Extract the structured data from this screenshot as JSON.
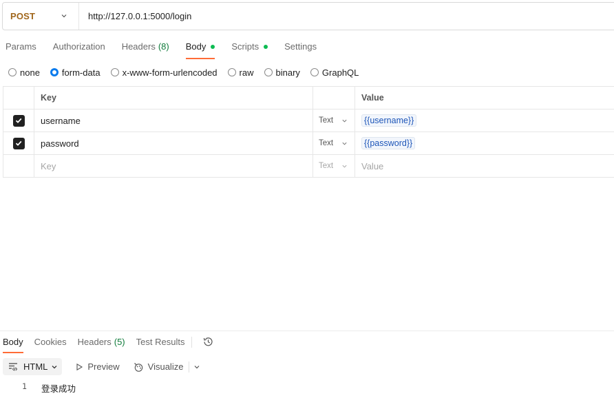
{
  "request": {
    "method": "POST",
    "url": "http://127.0.0.1:5000/login"
  },
  "request_tabs": [
    {
      "label": "Params"
    },
    {
      "label": "Authorization"
    },
    {
      "label": "Headers",
      "count": "(8)"
    },
    {
      "label": "Body",
      "active": true,
      "dot": true
    },
    {
      "label": "Scripts",
      "dot": true
    },
    {
      "label": "Settings"
    }
  ],
  "body_types": [
    "none",
    "form-data",
    "x-www-form-urlencoded",
    "raw",
    "binary",
    "GraphQL"
  ],
  "body_selected": "form-data",
  "table": {
    "header": {
      "key": "Key",
      "value": "Value"
    },
    "rows": [
      {
        "checked": true,
        "key": "username",
        "type": "Text",
        "value": "{{username}}"
      },
      {
        "checked": true,
        "key": "password",
        "type": "Text",
        "value": "{{password}}"
      }
    ],
    "empty_row": {
      "key_placeholder": "Key",
      "type": "Text",
      "value_placeholder": "Value"
    }
  },
  "response": {
    "tabs": [
      {
        "label": "Body",
        "active": true
      },
      {
        "label": "Cookies"
      },
      {
        "label": "Headers",
        "count": "(5)"
      },
      {
        "label": "Test Results"
      }
    ],
    "format": "HTML",
    "preview": "Preview",
    "visualize": "Visualize",
    "lines": [
      {
        "num": "1",
        "text": "登录成功"
      }
    ]
  },
  "colors": {
    "method": "#a0661b",
    "accent": "#ff6c37",
    "dot": "#0cbb52",
    "radio_selected": "#097bed",
    "variable": "#1d55b8"
  }
}
